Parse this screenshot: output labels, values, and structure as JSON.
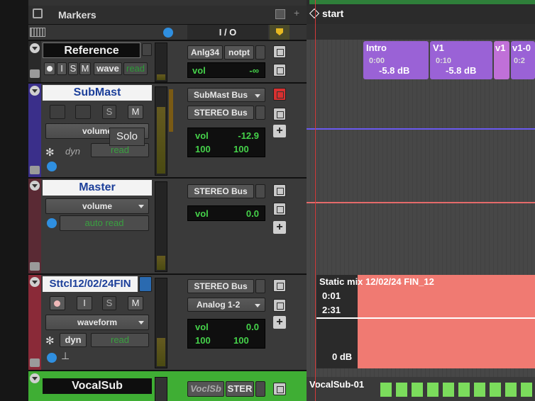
{
  "ruler": {
    "markers_label": "Markers",
    "start_marker": "start"
  },
  "header": {
    "io_label": "I / O"
  },
  "tracks": {
    "reference": {
      "name": "Reference",
      "btn_i": "I",
      "btn_s": "S",
      "btn_m": "M",
      "view": "wave",
      "auto": "read",
      "input": "Anlg34",
      "output": "notpt",
      "vol_label": "vol",
      "vol_value": "-∞"
    },
    "submast": {
      "name": "SubMast",
      "btn_s": "S",
      "btn_m": "M",
      "view": "volume",
      "dyn": "dyn",
      "auto": "read",
      "input": "SubMast Bus",
      "output": "STEREO Bus",
      "vol_label": "vol",
      "vol_value": "-12.9",
      "pan_left": "100",
      "pan_right": "100"
    },
    "master": {
      "name": "Master",
      "view": "volume",
      "auto": "auto read",
      "output": "STEREO Bus",
      "vol_label": "vol",
      "vol_value": "0.0"
    },
    "sttcl": {
      "name": "Sttcl12/02/24FIN",
      "btn_i": "I",
      "btn_s": "S",
      "btn_m": "M",
      "view": "waveform",
      "dyn": "dyn",
      "auto": "read",
      "output": "STEREO Bus",
      "input": "Analog 1-2",
      "vol_label": "vol",
      "vol_value": "0.0",
      "pan_left": "100",
      "pan_right": "100"
    },
    "vocalsub": {
      "name": "VocalSub",
      "input": "VoclSb",
      "output": "STER"
    }
  },
  "tooltip": "Solo",
  "clips": {
    "intro": {
      "name": "Intro",
      "time": "0:00",
      "gain": "-5.8 dB"
    },
    "v1": {
      "name": "V1",
      "time": "0:10",
      "gain": "-5.8 dB"
    },
    "v1b": {
      "name": "v1"
    },
    "v1c": {
      "name": "v1-0",
      "time": "0:2"
    },
    "static": {
      "name": "Static mix 12/02/24 FIN_12",
      "time1": "0:01",
      "time2": "2:31",
      "gain": "0 dB"
    },
    "vocalsub": {
      "name": "VocalSub-01"
    }
  },
  "colors": {
    "submast": "#3a2f8a",
    "master": "#5a2a34",
    "sttcl": "#8a2a38",
    "vocalsub": "#3fae34",
    "clip_purple": "#9a62d6",
    "clip_salmon": "#f07a72",
    "playhead": "#d23a3a"
  }
}
